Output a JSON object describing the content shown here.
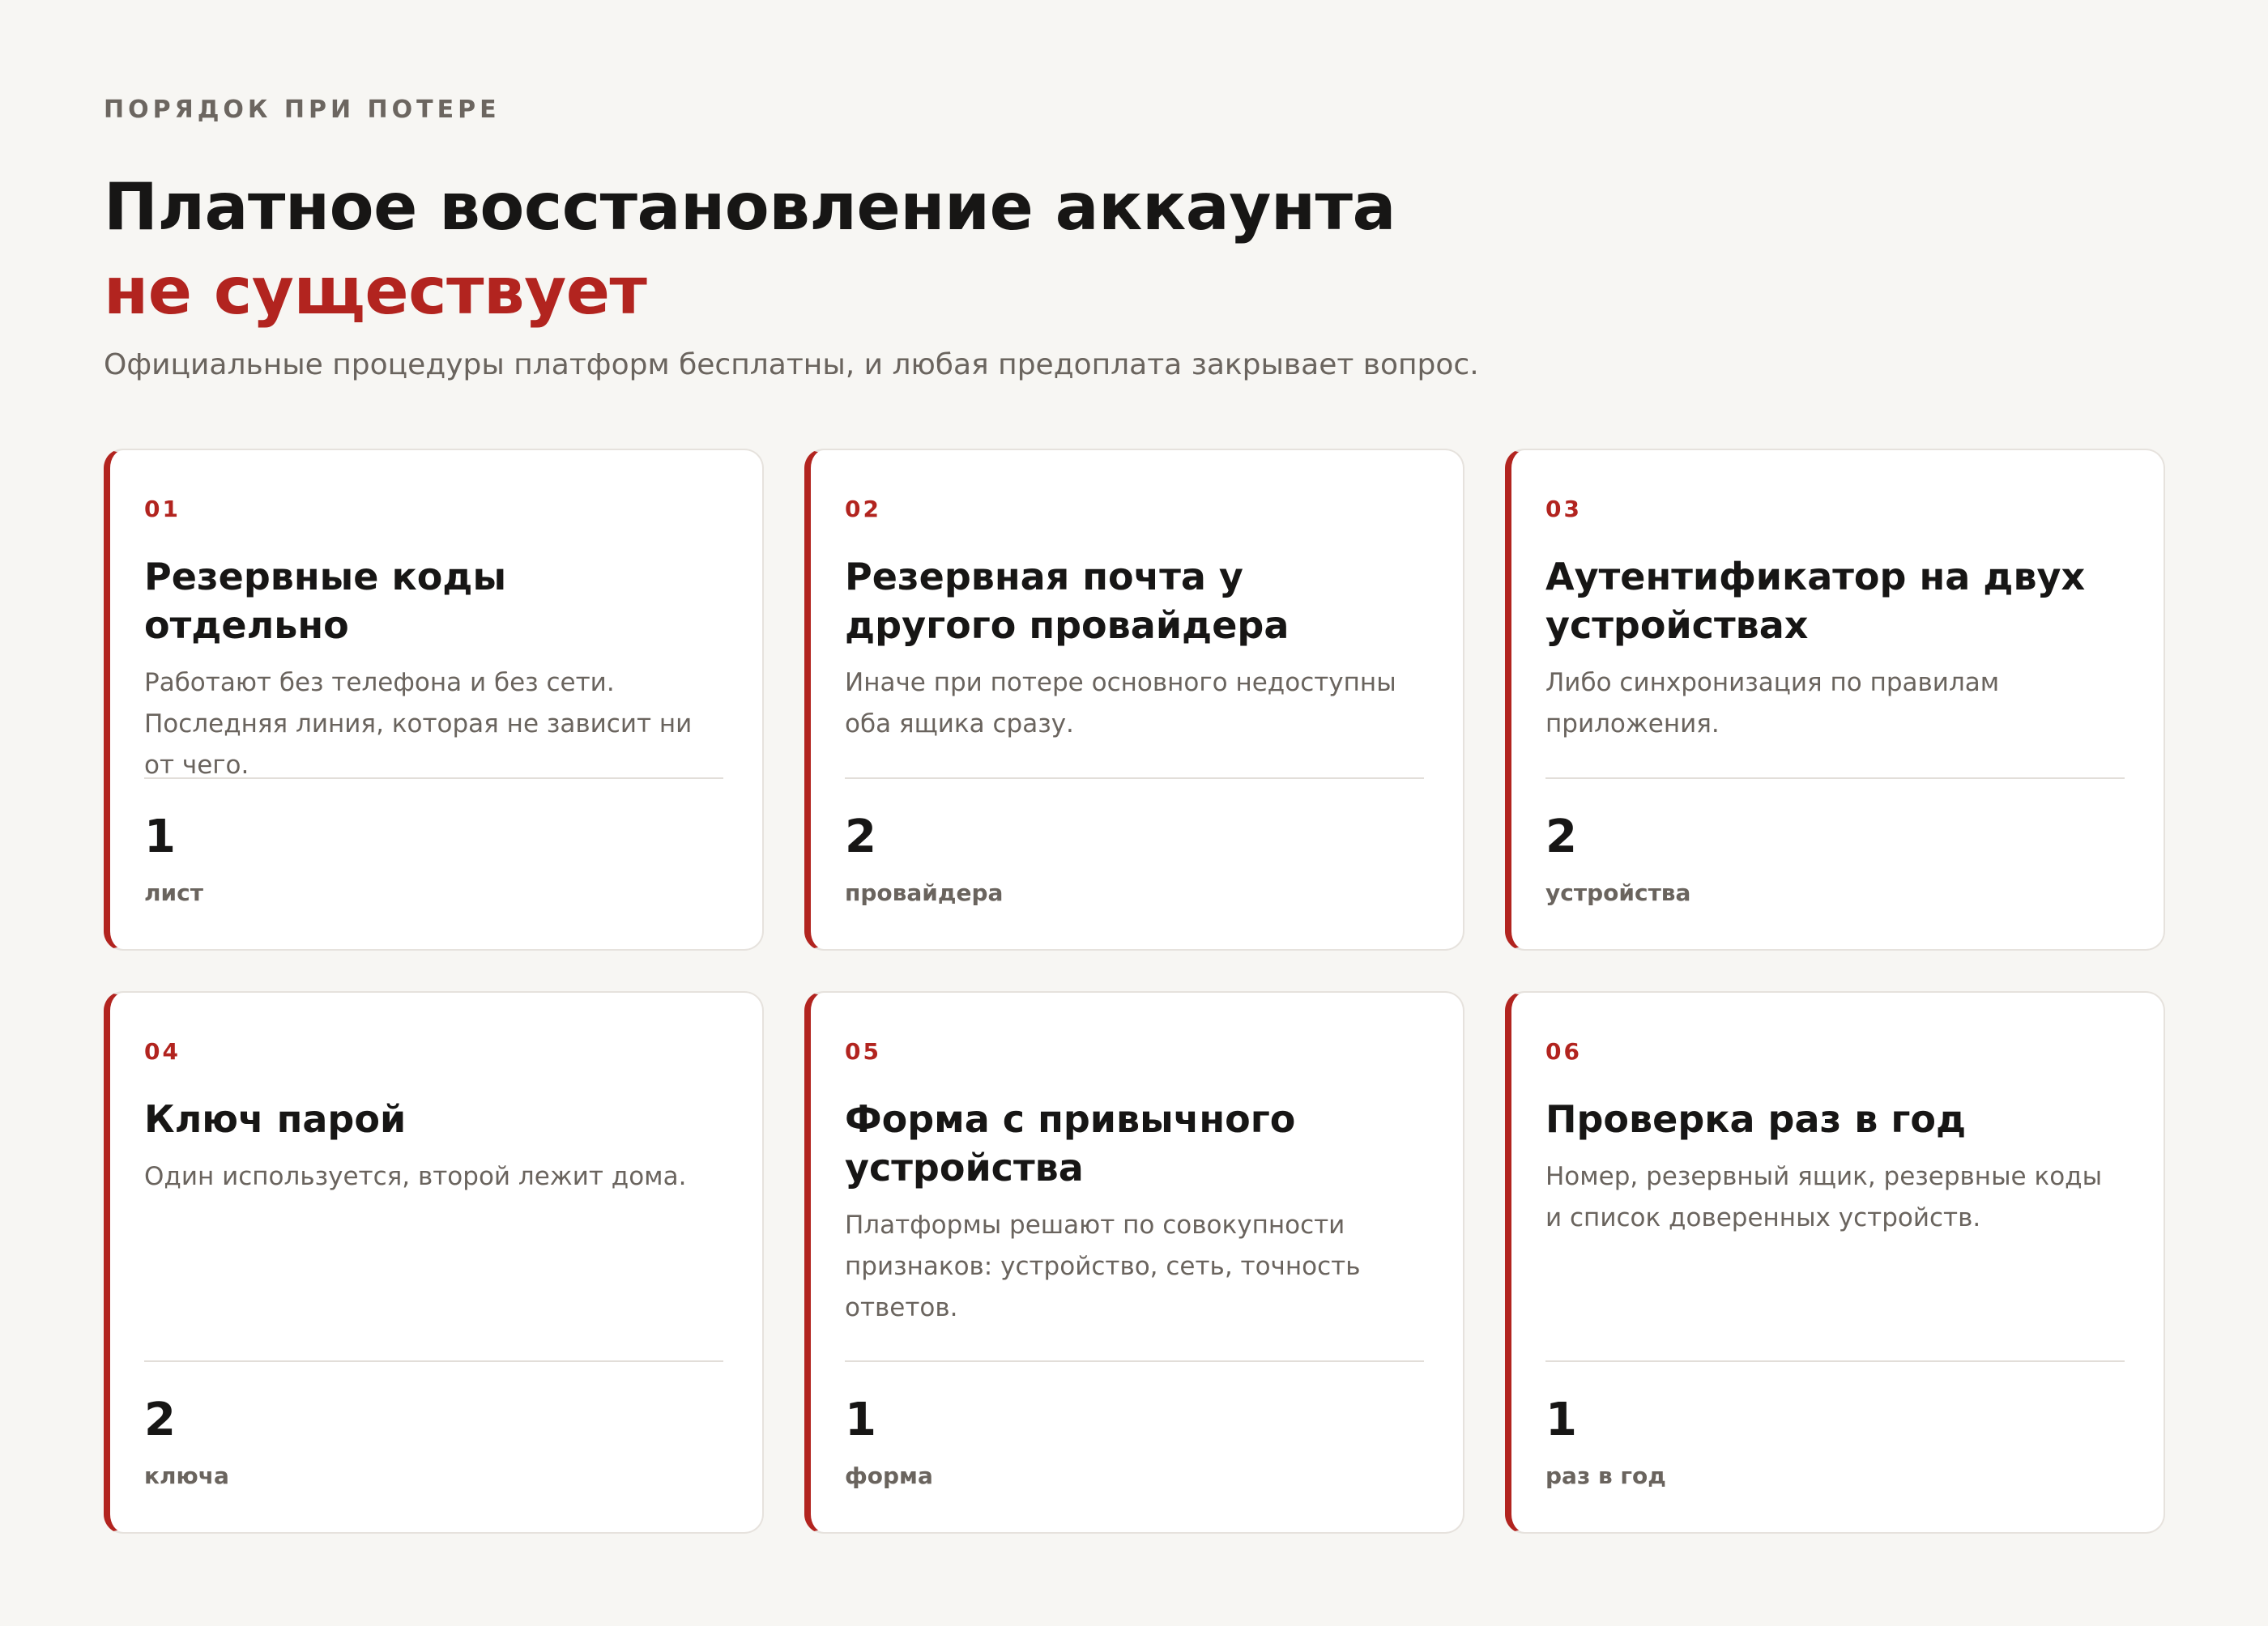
{
  "header": {
    "eyebrow": "ПОРЯДОК ПРИ ПОТЕРЕ",
    "headline_main": "Платное восстановление аккаунта",
    "headline_accent": "не существует",
    "subtitle": "Официальные процедуры платформ бесплатны, и любая предоплата закрывает вопрос."
  },
  "colors": {
    "accent": "#b2241f",
    "background": "#f7f6f3",
    "card": "#ffffff",
    "text": "#171615",
    "muted": "#6a645e"
  },
  "cards": [
    {
      "number": "01",
      "title": "Резервные коды отдельно",
      "description": "Работают без телефона и без сети. Последняя линия, которая не зависит ни от чего.",
      "metric": "1",
      "unit": "лист"
    },
    {
      "number": "02",
      "title": "Резервная почта у другого провайдера",
      "description": "Иначе при потере основного недоступны оба ящика сразу.",
      "metric": "2",
      "unit": "провайдера"
    },
    {
      "number": "03",
      "title": "Аутентификатор на двух устройствах",
      "description": "Либо синхронизация по правилам приложения.",
      "metric": "2",
      "unit": "устройства"
    },
    {
      "number": "04",
      "title": "Ключ парой",
      "description": "Один используется, второй лежит дома.",
      "metric": "2",
      "unit": "ключа"
    },
    {
      "number": "05",
      "title": "Форма с привычного устройства",
      "description": "Платформы решают по совокупности признаков: устройство, сеть, точность ответов.",
      "metric": "1",
      "unit": "форма"
    },
    {
      "number": "06",
      "title": "Проверка раз в год",
      "description": "Номер, резервный ящик, резервные коды и список доверенных устройств.",
      "metric": "1",
      "unit": "раз в год"
    }
  ]
}
